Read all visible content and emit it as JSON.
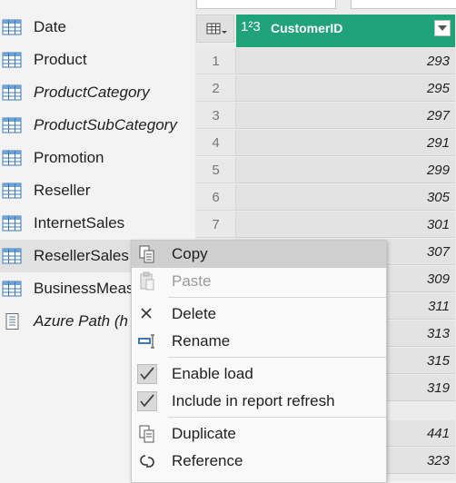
{
  "queries": [
    {
      "label": "Date",
      "italic": false,
      "icon": "table-icon"
    },
    {
      "label": "Product",
      "italic": false,
      "icon": "table-icon"
    },
    {
      "label": "ProductCategory",
      "italic": true,
      "icon": "table-icon"
    },
    {
      "label": "ProductSubCategory",
      "italic": true,
      "icon": "table-icon"
    },
    {
      "label": "Promotion",
      "italic": false,
      "icon": "table-icon"
    },
    {
      "label": "Reseller",
      "italic": false,
      "icon": "table-icon"
    },
    {
      "label": "InternetSales",
      "italic": false,
      "icon": "table-icon"
    },
    {
      "label": "ResellerSales",
      "italic": false,
      "icon": "table-icon",
      "selected": true
    },
    {
      "label": "BusinessMeas",
      "italic": false,
      "icon": "table-icon"
    },
    {
      "label": "Azure Path (h",
      "italic": true,
      "icon": "parameter-icon"
    }
  ],
  "grid": {
    "column_type": "1²3",
    "column_name": "CustomerID",
    "header_color": "#21a37a",
    "rows": [
      {
        "n": "1",
        "v": "293"
      },
      {
        "n": "2",
        "v": "295"
      },
      {
        "n": "3",
        "v": "297"
      },
      {
        "n": "4",
        "v": "291"
      },
      {
        "n": "5",
        "v": "299"
      },
      {
        "n": "6",
        "v": "305"
      },
      {
        "n": "7",
        "v": "301"
      },
      {
        "n": "",
        "v": "307"
      },
      {
        "n": "",
        "v": "309"
      },
      {
        "n": "",
        "v": "311"
      },
      {
        "n": "",
        "v": "313"
      },
      {
        "n": "",
        "v": "315"
      },
      {
        "n": "",
        "v": "319"
      },
      {
        "n": "",
        "v": "441"
      },
      {
        "n": "",
        "v": "323"
      }
    ]
  },
  "context_menu": {
    "copy": "Copy",
    "paste": "Paste",
    "delete": "Delete",
    "rename": "Rename",
    "enable_load": "Enable load",
    "include_refresh": "Include in report refresh",
    "duplicate": "Duplicate",
    "reference": "Reference"
  }
}
